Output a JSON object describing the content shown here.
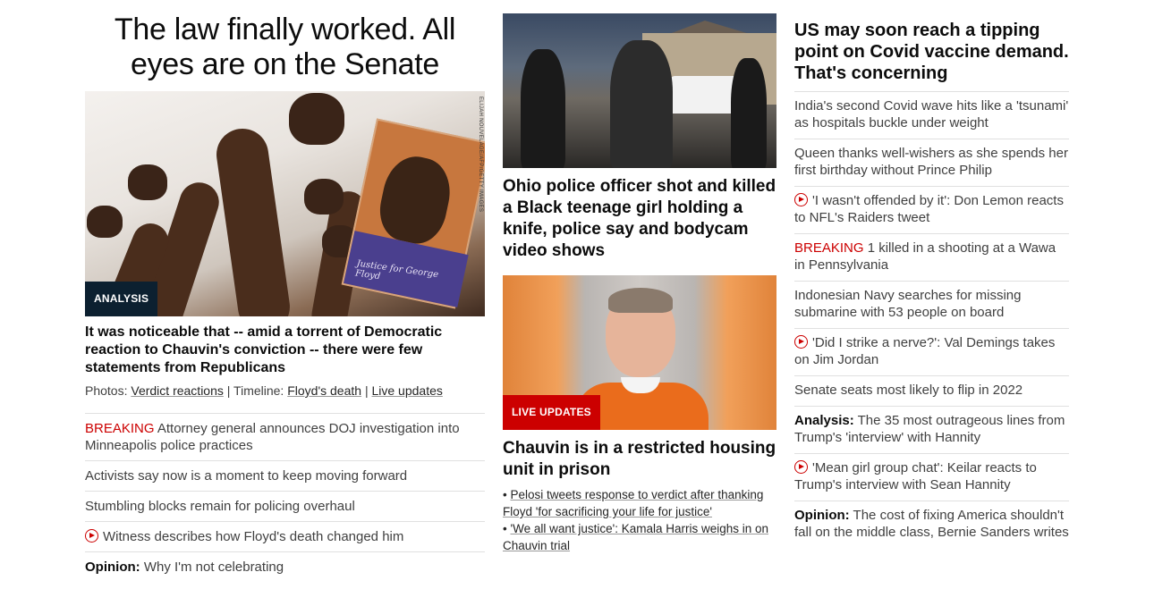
{
  "left": {
    "headline": "The law finally worked. All eyes are on the Senate",
    "image_credit": "ELIJAH NOUVELAGE/AFP/GETTY IMAGES",
    "poster_text": "Justice for George Floyd",
    "badge": "ANALYSIS",
    "description": "It was noticeable that -- amid a torrent of Democratic reaction to Chauvin's conviction -- there were few statements from Republicans",
    "photos_label": "Photos:",
    "photos_link": "Verdict reactions",
    "sep1": " | ",
    "timeline_label": "Timeline:",
    "timeline_link": "Floyd's death",
    "sep2": " | ",
    "live_link": "Live updates",
    "items": [
      {
        "prefix": "BREAKING",
        "text": " Attorney general announces DOJ investigation into Minneapolis police practices"
      },
      {
        "text": "Activists say now is a moment to keep moving forward"
      },
      {
        "text": "Stumbling blocks remain for policing overhaul"
      },
      {
        "video": true,
        "text": "Witness describes how Floyd's death changed him"
      },
      {
        "label": "Opinion:",
        "text": " Why I'm not celebrating"
      }
    ]
  },
  "middle": {
    "story1_title": "Ohio police officer shot and killed a Black teenage girl holding a knife, police say and bodycam video shows",
    "badge": "LIVE UPDATES",
    "story2_title": "Chauvin is in a restricted housing unit in prison",
    "bullets": [
      "Pelosi tweets response to verdict after thanking Floyd 'for sacrificing your life for justice'",
      "'We all want justice': Kamala Harris weighs in on Chauvin trial"
    ],
    "bullet_char": "•"
  },
  "right": {
    "headline": "US may soon reach a tipping point on Covid vaccine demand. That's concerning",
    "items": [
      {
        "text": "India's second Covid wave hits like a 'tsunami' as hospitals buckle under weight"
      },
      {
        "text": "Queen thanks well-wishers as she spends her first birthday without Prince Philip"
      },
      {
        "video": true,
        "text": "'I wasn't offended by it': Don Lemon reacts to NFL's Raiders tweet"
      },
      {
        "prefix": "BREAKING",
        "text": " 1 killed in a shooting at a Wawa in Pennsylvania"
      },
      {
        "text": "Indonesian Navy searches for missing submarine with 53 people on board"
      },
      {
        "video": true,
        "text": "'Did I strike a nerve?': Val Demings takes on Jim Jordan"
      },
      {
        "text": "Senate seats most likely to flip in 2022"
      },
      {
        "label": "Analysis:",
        "text": " The 35 most outrageous lines from Trump's 'interview' with Hannity"
      },
      {
        "video": true,
        "text": "'Mean girl group chat': Keilar reacts to Trump's interview with Sean Hannity"
      },
      {
        "label": "Opinion:",
        "text": " The cost of fixing America shouldn't fall on the middle class, Bernie Sanders writes"
      }
    ]
  },
  "colors": {
    "breaking": "#cc0000",
    "analysis_badge": "#0c2030",
    "live_badge": "#cc0000"
  }
}
